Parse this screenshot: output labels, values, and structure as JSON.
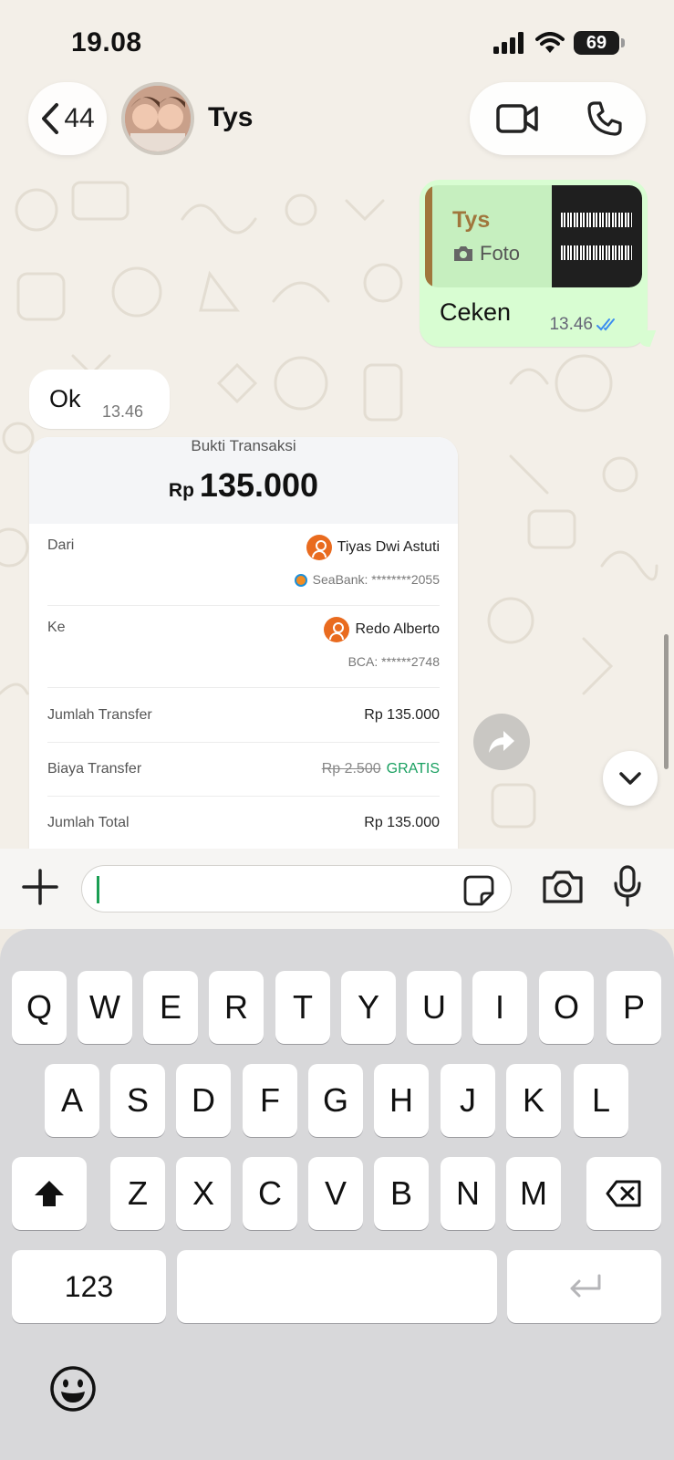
{
  "status_bar": {
    "time": "19.08",
    "battery": "69"
  },
  "header": {
    "back_count": "44",
    "contact_name": "Tys"
  },
  "messages": {
    "outgoing": {
      "quote_name": "Tys",
      "quote_type": "Foto",
      "text": "Ceken",
      "time": "13.46"
    },
    "incoming": {
      "text": "Ok",
      "time": "13.46"
    }
  },
  "receipt": {
    "title": "Bukti Transaksi",
    "currency": "Rp",
    "amount": "135.000",
    "from_label": "Dari",
    "from_name": "Tiyas Dwi Astuti",
    "from_bank": "SeaBank: ********2055",
    "to_label": "Ke",
    "to_name": "Redo Alberto",
    "to_bank": "BCA: ******2748",
    "transfer_label": "Jumlah Transfer",
    "transfer_value": "Rp 135.000",
    "fee_label": "Biaya Transfer",
    "fee_original": "Rp 2.500",
    "fee_value": "GRATIS",
    "total_label": "Jumlah Total",
    "total_value": "Rp 135.000"
  },
  "keyboard": {
    "row1": [
      "Q",
      "W",
      "E",
      "R",
      "T",
      "Y",
      "U",
      "I",
      "O",
      "P"
    ],
    "row2": [
      "A",
      "S",
      "D",
      "F",
      "G",
      "H",
      "J",
      "K",
      "L"
    ],
    "row3": [
      "Z",
      "X",
      "C",
      "V",
      "B",
      "N",
      "M"
    ],
    "numbers_key": "123"
  },
  "colors": {
    "outgoing_bubble": "#d8fdd2",
    "accent_green": "#1aa061",
    "quote_accent": "#a0763c",
    "read_ticks": "#3b8cf0"
  }
}
